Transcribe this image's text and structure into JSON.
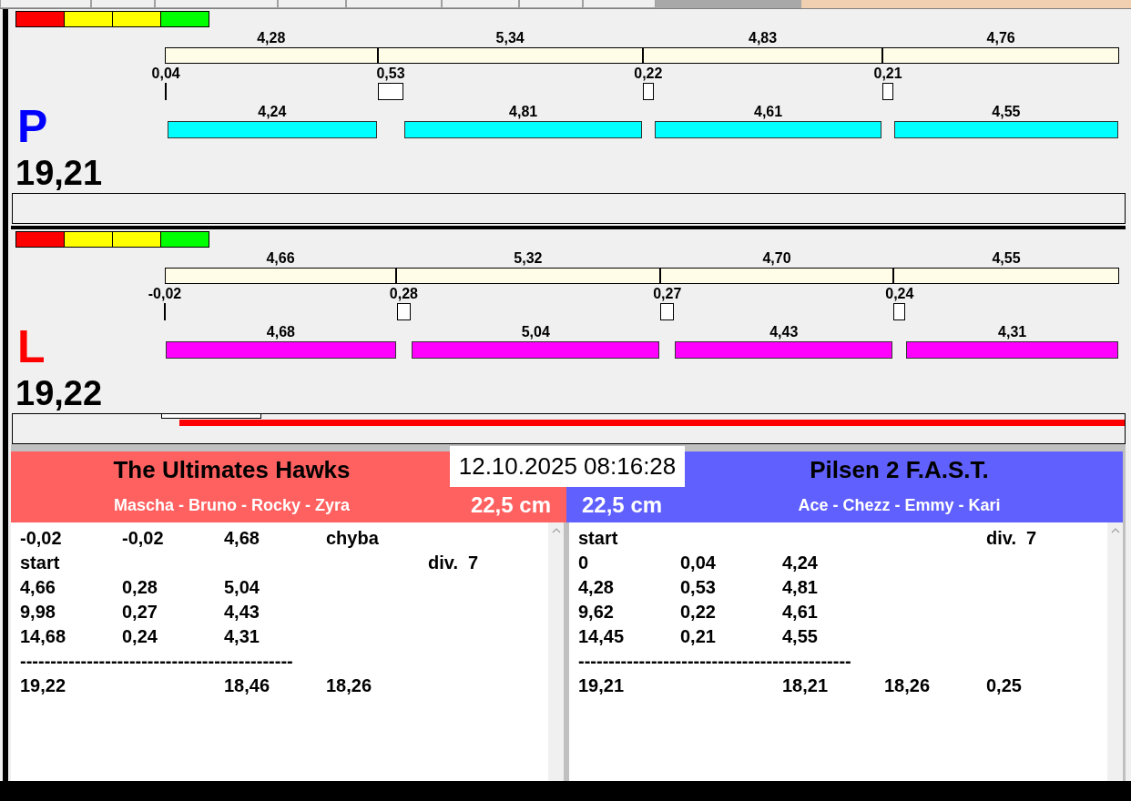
{
  "lanes": [
    {
      "letter": "P",
      "color": "#0000ff",
      "lights": [
        {
          "color": "#ff0000"
        },
        {
          "color": "#ffff00"
        },
        {
          "color": "#ffff00"
        },
        {
          "color": "#00ff00"
        }
      ],
      "total": "19,21",
      "segments": [
        {
          "split": "4,28",
          "reaction": "0,04",
          "run": "4,24"
        },
        {
          "split": "5,34",
          "reaction": "0,53",
          "run": "4,81"
        },
        {
          "split": "4,83",
          "reaction": "0,22",
          "run": "4,61"
        },
        {
          "split": "4,76",
          "reaction": "0,21",
          "run": "4,55"
        }
      ],
      "bar": {
        "color": "#00ffff"
      },
      "progress": {
        "level": 0,
        "marker": false
      }
    },
    {
      "letter": "L",
      "color": "#ff0000",
      "lights": [
        {
          "color": "#ff0000"
        },
        {
          "color": "#ffff00"
        },
        {
          "color": "#ffff00"
        },
        {
          "color": "#00ff00"
        }
      ],
      "total": "19,22",
      "segments": [
        {
          "split": "4,66",
          "reaction": "-0,02",
          "run": "4,68"
        },
        {
          "split": "5,32",
          "reaction": "0,28",
          "run": "5,04"
        },
        {
          "split": "4,70",
          "reaction": "0,27",
          "run": "4,43"
        },
        {
          "split": "4,55",
          "reaction": "0,24",
          "run": "4,31"
        }
      ],
      "bar": {
        "color": "#ff00ff"
      },
      "progress": {
        "level": 0.85,
        "marker": true
      }
    }
  ],
  "results": {
    "date": "12.10.2025 08:16:28",
    "teams": [
      {
        "name": "The Ultimates Hawks",
        "members": "Mascha - Bruno - Rocky - Zyra",
        "distance": "22,5 cm",
        "color": "#ff6060",
        "rows": [
          {
            "c1": "-0,02",
            "c2": "-0,02",
            "c3": "4,68",
            "c4": "chyba"
          },
          {
            "c1": "start",
            "c5": "div.  7"
          },
          {
            "c1": "4,66",
            "c2": "0,28",
            "c3": "5,04"
          },
          {
            "c1": "9,98",
            "c2": "0,27",
            "c3": "4,43"
          },
          {
            "c1": "14,68",
            "c2": "0,24",
            "c3": "4,31"
          },
          {
            "c1": "---------------------------------------------"
          },
          {
            "c1": "19,22",
            "c3": "18,46",
            "c4": "18,26"
          }
        ]
      },
      {
        "name": "Pilsen 2 F.A.S.T.",
        "members": "Ace - Chezz - Emmy - Kari",
        "distance": "22,5 cm",
        "color": "#6060ff",
        "rows": [
          {
            "c1": "start",
            "c5": "div.  7"
          },
          {
            "c1": "0",
            "c2": "0,04",
            "c3": "4,24"
          },
          {
            "c1": "4,28",
            "c2": "0,53",
            "c3": "4,81"
          },
          {
            "c1": "9,62",
            "c2": "0,22",
            "c3": "4,61"
          },
          {
            "c1": "14,45",
            "c2": "0,21",
            "c3": "4,55"
          },
          {
            "c1": "---------------------------------------------"
          },
          {
            "c1": "19,21",
            "c3": "18,21",
            "c4": "18,26",
            "c5": "0,25"
          }
        ]
      }
    ]
  }
}
